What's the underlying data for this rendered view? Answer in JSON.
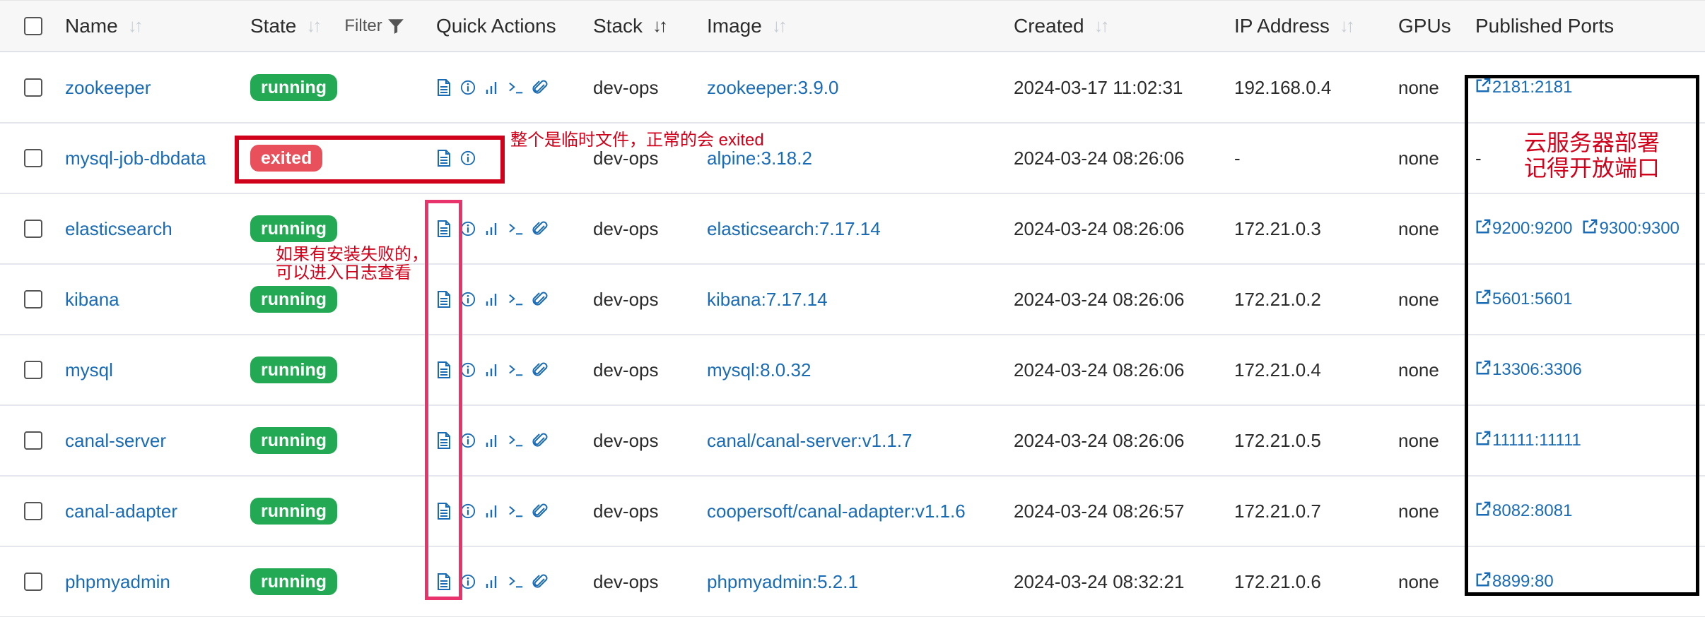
{
  "header": {
    "name": "Name",
    "state": "State",
    "filter": "Filter",
    "quick_actions": "Quick Actions",
    "stack": "Stack",
    "image": "Image",
    "created": "Created",
    "ip": "IP Address",
    "gpus": "GPUs",
    "ports": "Published Ports"
  },
  "rows": [
    {
      "name": "zookeeper",
      "state": "running",
      "actions": [
        "logs",
        "inspect",
        "stats",
        "console",
        "attach"
      ],
      "stack": "dev-ops",
      "image": "zookeeper:3.9.0",
      "created": "2024-03-17 11:02:31",
      "ip": "192.168.0.4",
      "gpus": "none",
      "ports": [
        "2181:2181"
      ]
    },
    {
      "name": "mysql-job-dbdata",
      "state": "exited",
      "actions": [
        "logs",
        "inspect"
      ],
      "stack": "dev-ops",
      "image": "alpine:3.18.2",
      "created": "2024-03-24 08:26:06",
      "ip": "-",
      "gpus": "none",
      "ports": [],
      "ports_text": "-"
    },
    {
      "name": "elasticsearch",
      "state": "running",
      "actions": [
        "logs",
        "inspect",
        "stats",
        "console",
        "attach"
      ],
      "stack": "dev-ops",
      "image": "elasticsearch:7.17.14",
      "created": "2024-03-24 08:26:06",
      "ip": "172.21.0.3",
      "gpus": "none",
      "ports": [
        "9200:9200",
        "9300:9300"
      ]
    },
    {
      "name": "kibana",
      "state": "running",
      "actions": [
        "logs",
        "inspect",
        "stats",
        "console",
        "attach"
      ],
      "stack": "dev-ops",
      "image": "kibana:7.17.14",
      "created": "2024-03-24 08:26:06",
      "ip": "172.21.0.2",
      "gpus": "none",
      "ports": [
        "5601:5601"
      ]
    },
    {
      "name": "mysql",
      "state": "running",
      "actions": [
        "logs",
        "inspect",
        "stats",
        "console",
        "attach"
      ],
      "stack": "dev-ops",
      "image": "mysql:8.0.32",
      "created": "2024-03-24 08:26:06",
      "ip": "172.21.0.4",
      "gpus": "none",
      "ports": [
        "13306:3306"
      ]
    },
    {
      "name": "canal-server",
      "state": "running",
      "actions": [
        "logs",
        "inspect",
        "stats",
        "console",
        "attach"
      ],
      "stack": "dev-ops",
      "image": "canal/canal-server:v1.1.7",
      "created": "2024-03-24 08:26:06",
      "ip": "172.21.0.5",
      "gpus": "none",
      "ports": [
        "11111:11111"
      ]
    },
    {
      "name": "canal-adapter",
      "state": "running",
      "actions": [
        "logs",
        "inspect",
        "stats",
        "console",
        "attach"
      ],
      "stack": "dev-ops",
      "image": "coopersoft/canal-adapter:v1.1.6",
      "created": "2024-03-24 08:26:57",
      "ip": "172.21.0.7",
      "gpus": "none",
      "ports": [
        "8082:8081"
      ]
    },
    {
      "name": "phpmyadmin",
      "state": "running",
      "actions": [
        "logs",
        "inspect",
        "stats",
        "console",
        "attach"
      ],
      "stack": "dev-ops",
      "image": "phpmyadmin:5.2.1",
      "created": "2024-03-24 08:32:21",
      "ip": "172.21.0.6",
      "gpus": "none",
      "ports": [
        "8899:80"
      ]
    }
  ],
  "annotations": {
    "exited_note": "整个是临时文件，正常的会 exited",
    "logs_note_line1": "如果有安装失败的，",
    "logs_note_line2": "可以进入日志查看",
    "ports_note_line1": "云服务器部署",
    "ports_note_line2": "记得开放端口"
  },
  "colors": {
    "link": "#1a6bb5",
    "running": "#23a953",
    "exited": "#e8505b",
    "annotation_red": "#d0021b",
    "annotation_pink": "#e8336d",
    "annotation_black": "#000000"
  }
}
